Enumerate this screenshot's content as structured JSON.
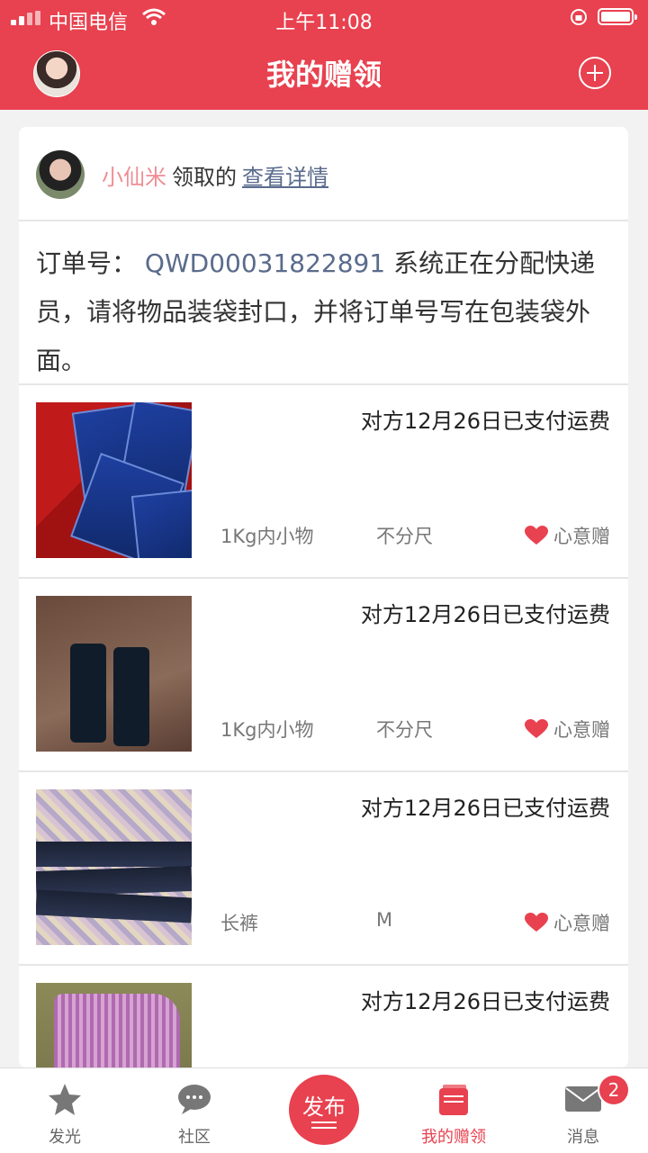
{
  "status_bar": {
    "carrier": "中国电信",
    "time": "上午11:08"
  },
  "header": {
    "title": "我的赠领"
  },
  "card": {
    "user": "小仙米",
    "taken_text": "领取的",
    "detail_link": "查看详情",
    "order_label": "订单号：",
    "order_number": "QWD00031822891",
    "order_message": " 系统正在分配快递员，请将物品装袋封口，并将订单号写在包装袋外面。"
  },
  "items": [
    {
      "paid": "对方12月26日已支付运费",
      "category": "1Kg内小物",
      "size": "不分尺",
      "tag": "心意赠"
    },
    {
      "paid": "对方12月26日已支付运费",
      "category": "1Kg内小物",
      "size": "不分尺",
      "tag": "心意赠"
    },
    {
      "paid": "对方12月26日已支付运费",
      "category": "长裤",
      "size": "M",
      "tag": "心意赠"
    },
    {
      "paid": "对方12月26日已支付运费"
    }
  ],
  "tabbar": {
    "tabs": [
      {
        "label": "发光",
        "icon": "star-icon"
      },
      {
        "label": "社区",
        "icon": "chat-bubble-icon"
      },
      {
        "label": "我的赠领",
        "icon": "gift-list-icon"
      },
      {
        "label": "消息",
        "icon": "mail-icon"
      }
    ],
    "publish": "发布",
    "message_badge": "2"
  },
  "colors": {
    "accent": "#e8414f",
    "link": "#5a6b8c",
    "username": "#ee8e94"
  }
}
